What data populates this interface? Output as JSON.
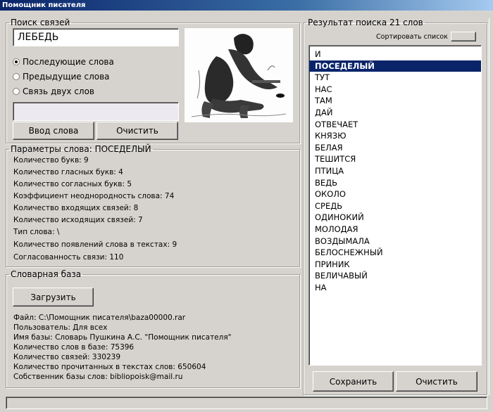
{
  "window": {
    "title": "Помощник писателя"
  },
  "search": {
    "legend": "Поиск связей",
    "word_value": "ЛЕБЕДЬ",
    "extra_value": "",
    "radios": [
      {
        "label": "Последующие слова",
        "checked": true
      },
      {
        "label": "Предыдущие слова",
        "checked": false
      },
      {
        "label": "Связь двух слов",
        "checked": false
      }
    ],
    "enter_label": "Ввод слова",
    "clear_label": "Очистить"
  },
  "params": {
    "legend": "Параметры слова: ПОСЕДЕЛЫЙ",
    "lines": [
      "Количество букв: 9",
      "Количество гласных букв: 4",
      "Количество согласных букв: 5",
      "Коэффициент неоднородность слова: 74",
      "Количество входящих связей: 8",
      "Количество исходящих связей: 7",
      "Тип слова: \\",
      "Количество появлений слова в текстах: 9",
      "Согласованность связи: 110"
    ]
  },
  "dictionary": {
    "legend": "Словарная база",
    "load_label": "Загрузить",
    "lines": [
      "Файл: C:\\Помощник писателя\\baza00000.rar",
      "Пользователь: Для всех",
      "Имя базы: Словарь Пушкина А.С. \"Помощник писателя\"",
      "Количество слов в базе: 75396",
      "Количество связей: 330239",
      "Количество прочитанных в текстах слов: 650604",
      "Собственник базы слов: bibliopoisk@mail.ru"
    ]
  },
  "results": {
    "legend": "Результат поиска 21 слов",
    "sort_label": "Сортировать список",
    "selected_index": 1,
    "items": [
      "И",
      "ПОСЕДЕЛЫЙ",
      "ТУТ",
      "НАС",
      "ТАМ",
      "ДАЙ",
      "ОТВЕЧАЕТ",
      "КНЯЗЮ",
      "БЕЛАЯ",
      "ТЕШИТСЯ",
      "ПТИЦА",
      "ВЕДЬ",
      "ОКОЛО",
      "СРЕДЬ",
      "ОДИНОКИЙ",
      "МОЛОДАЯ",
      "ВОЗДЫМАЛА",
      "БЕЛОСНЕЖНЫЙ",
      "ПРИНИК",
      "ВЕЛИЧАВЫЙ",
      "НА"
    ],
    "save_label": "Сохранить",
    "clear_label": "Очистить"
  }
}
